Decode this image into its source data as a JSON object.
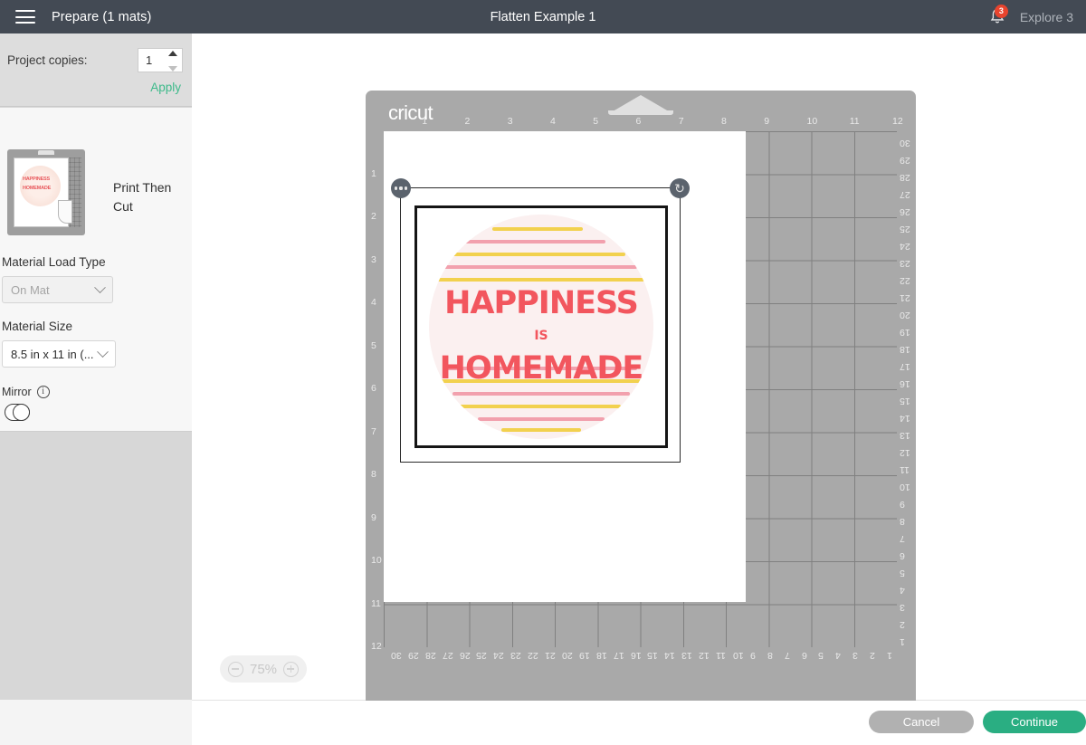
{
  "topbar": {
    "menu_icon": "hamburger-icon",
    "left_title": "Prepare (1 mats)",
    "center_title": "Flatten Example 1",
    "bell_icon": "bell-icon",
    "notification_count": "3",
    "account_label": "Explore 3",
    "bg_color": "#434a54"
  },
  "sidebar": {
    "copies_label": "Project copies:",
    "copies_value": "1",
    "apply_label": "Apply",
    "apply_color": "#3dba8a",
    "operation_label": "Print Then Cut",
    "material_load_type_label": "Material Load Type",
    "material_load_type_value": "On Mat",
    "material_size_label": "Material Size",
    "material_size_value": "8.5 in x 11 in (...",
    "mirror_label": "Mirror",
    "mirror_info_icon": "info-icon",
    "mirror_state": "off",
    "thumbnail": {
      "art_line1": "HAPPINESS",
      "art_line2": "HOMEMADE"
    }
  },
  "canvas": {
    "zoom_level": "75%",
    "zoom_out_icon": "minus-circle-icon",
    "zoom_in_icon": "plus-circle-icon",
    "mat": {
      "brand": "cricut",
      "ruler_top": [
        "1",
        "2",
        "3",
        "4",
        "5",
        "6",
        "7",
        "8",
        "9",
        "10",
        "11",
        "12"
      ],
      "ruler_left": [
        "1",
        "2",
        "3",
        "4",
        "5",
        "6",
        "7",
        "8",
        "9",
        "10",
        "11",
        "12"
      ],
      "ruler_right": [
        "30",
        "29",
        "28",
        "27",
        "26",
        "25",
        "24",
        "23",
        "22",
        "21",
        "20",
        "19",
        "18",
        "17",
        "16",
        "15",
        "14",
        "13",
        "12",
        "11",
        "10",
        "9",
        "8",
        "7",
        "6",
        "5",
        "4",
        "3",
        "2",
        "1"
      ],
      "ruler_bottom": [
        "30",
        "29",
        "28",
        "27",
        "26",
        "25",
        "24",
        "23",
        "22",
        "21",
        "20",
        "19",
        "18",
        "17",
        "16",
        "15",
        "14",
        "13",
        "12",
        "11",
        "10",
        "9",
        "8",
        "7",
        "6",
        "5",
        "4",
        "3",
        "2",
        "1"
      ],
      "mat_color": "#a9a9a9",
      "page_color": "#ffffff"
    },
    "artwork": {
      "line1": "HAPPINESS",
      "connector": "IS",
      "line2": "HOMEMADE",
      "text_color": "#f2565e",
      "circle_color": "#fbf0f0",
      "accent_yellow": "#f2d14e",
      "accent_pink": "#f2a0ad"
    },
    "selection": {
      "more_handle_icon": "more-dots-icon",
      "rotate_handle_icon": "rotate-icon"
    }
  },
  "footer": {
    "cancel_label": "Cancel",
    "continue_label": "Continue",
    "cancel_color": "#b1b1b1",
    "continue_color": "#2aae82"
  }
}
